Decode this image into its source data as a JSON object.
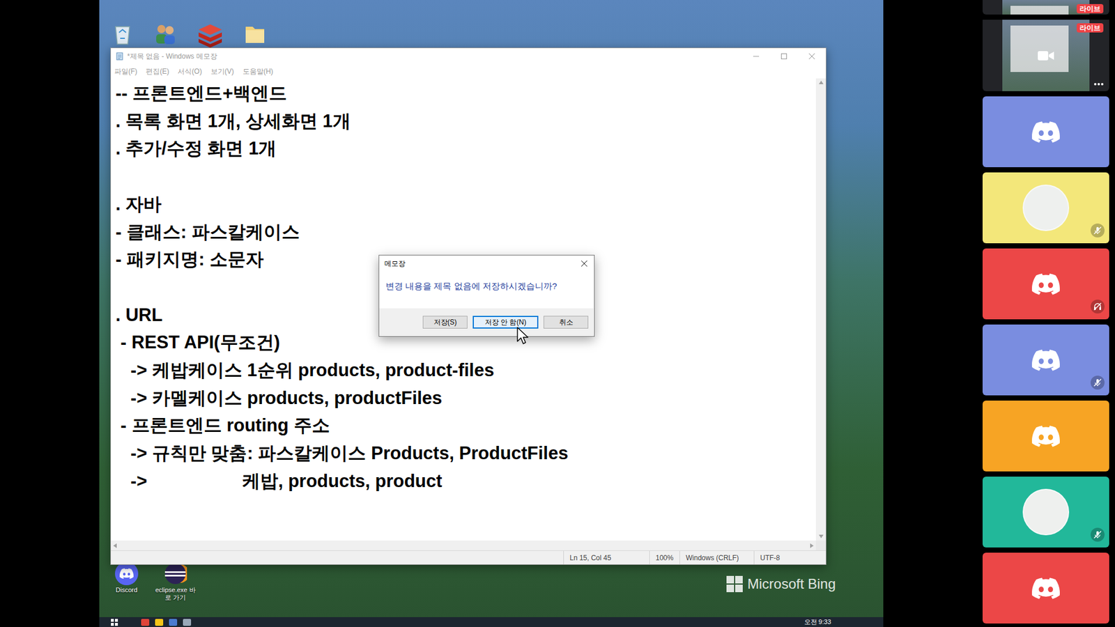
{
  "desktop": {
    "shortcuts": [
      {
        "label": "Discord"
      },
      {
        "label": "eclipse.exe 바로 가기"
      }
    ],
    "watermark": "Microsoft Bing"
  },
  "notepad": {
    "title": "*제목 없음 - Windows 메모장",
    "menu": [
      "파일(F)",
      "편집(E)",
      "서식(O)",
      "보기(V)",
      "도움말(H)"
    ],
    "lines": [
      "-- 프론트엔드+백엔드",
      ". 목록 화면 1개, 상세화면 1개",
      ". 추가/수정 화면 1개",
      "",
      ". 자바",
      "- 클래스: 파스칼케이스",
      "- 패키지명: 소문자",
      "",
      ". URL",
      " - REST API(무조건)",
      "   -> 케밥케이스 1순위 products, product-files",
      "   -> 카멜케이스 products, productFiles",
      " - 프론트엔드 routing 주소",
      "   -> 규칙만 맞춤: 파스칼케이스 Products, ProductFiles",
      "   ->                   케밥, products, product"
    ],
    "status": {
      "position": "Ln 15, Col 45",
      "zoom": "100%",
      "line_ending": "Windows (CRLF)",
      "encoding": "UTF-8"
    }
  },
  "dialog": {
    "title": "메모장",
    "message": "변경 내용을 제목 없음에 저장하시겠습니까?",
    "buttons": [
      {
        "label": "저장(S)",
        "selected": false
      },
      {
        "label": "저장 안 함(N)",
        "selected": true
      },
      {
        "label": "취소",
        "selected": false
      }
    ]
  },
  "taskbar": {
    "clock": "오전 9:33"
  },
  "sidebar": {
    "streams": [
      {
        "badge": "라이브"
      },
      {
        "badge": "라이브"
      }
    ],
    "participants": [
      {
        "kind": "logo",
        "color": "#7a8de0",
        "muted": false,
        "deafened": false
      },
      {
        "kind": "avatar",
        "color": "#f3e77a",
        "muted": true,
        "deafened": false
      },
      {
        "kind": "logo",
        "color": "#ec4747",
        "muted": false,
        "deafened": true
      },
      {
        "kind": "logo",
        "color": "#7a8de0",
        "muted": true,
        "deafened": false
      },
      {
        "kind": "logo",
        "color": "#f7a424",
        "muted": false,
        "deafened": false
      },
      {
        "kind": "avatar",
        "color": "#22b89a",
        "muted": true,
        "deafened": false
      },
      {
        "kind": "logo",
        "color": "#ec4747",
        "muted": false,
        "deafened": false
      }
    ]
  }
}
